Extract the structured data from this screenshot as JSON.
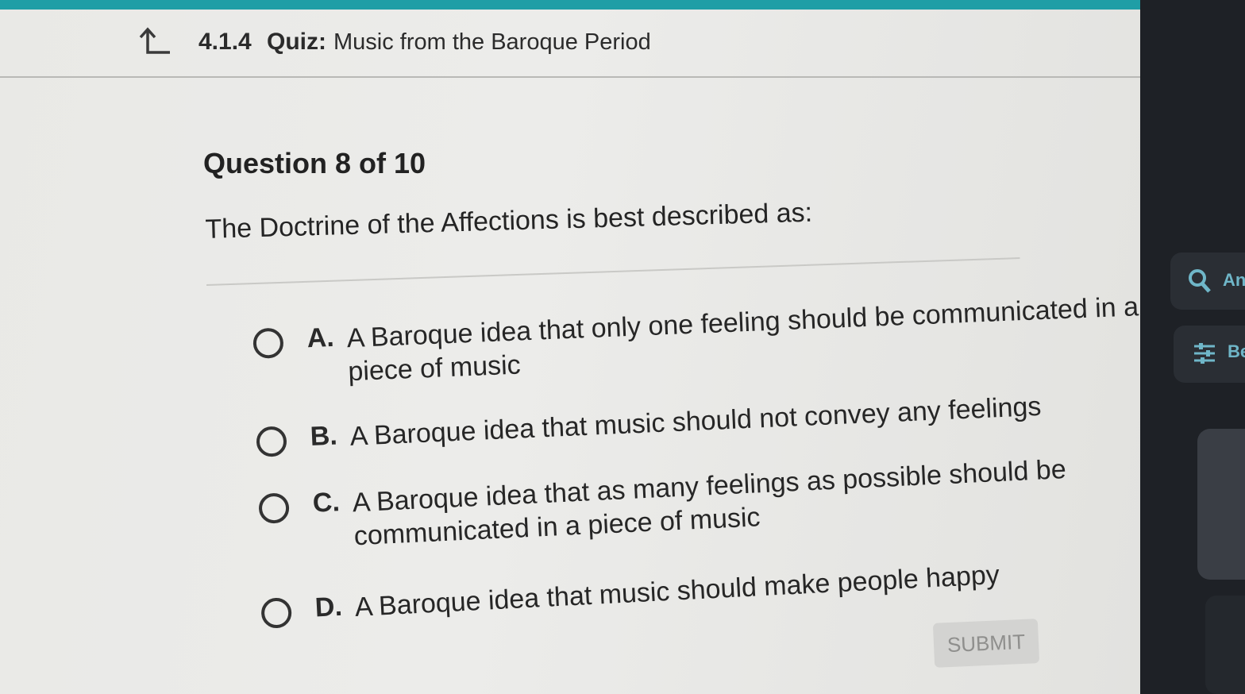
{
  "header": {
    "quiz_code": "4.1.4",
    "quiz_kind": "Quiz:",
    "quiz_title": "Music from the Baroque Period",
    "back_icon": "arrow-up-left-icon"
  },
  "question": {
    "number_label": "Question 8 of 10",
    "text": "The Doctrine of the Affections is best described as:"
  },
  "options": [
    {
      "letter": "A.",
      "lines": [
        "A Baroque idea that only one feeling should be communicated in a",
        "piece of music"
      ]
    },
    {
      "letter": "B.",
      "lines": [
        "A Baroque idea that music should not convey any feelings"
      ]
    },
    {
      "letter": "C.",
      "lines": [
        "A Baroque idea that as many feelings as possible should be",
        "communicated in a piece of music"
      ]
    },
    {
      "letter": "D.",
      "lines": [
        "A Baroque idea that music should make people happy"
      ]
    }
  ],
  "submit_label": "SUBMIT",
  "side_panel": {
    "item1_label": "An",
    "item2_label": "Be",
    "item1_icon": "search-icon",
    "item2_icon": "sliders-icon"
  },
  "colors": {
    "accent_teal": "#1f9ea6",
    "page_bg": "#ebebe8",
    "text": "#262626"
  }
}
